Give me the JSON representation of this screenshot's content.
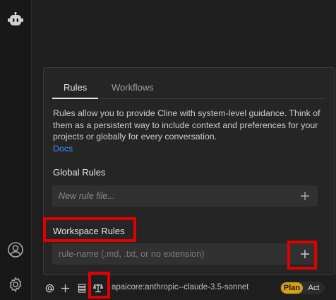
{
  "tabs": [
    {
      "label": "Rules",
      "active": true
    },
    {
      "label": "Workflows",
      "active": false
    }
  ],
  "description": "Rules allow you to provide Cline with system-level guidance. Think of them as a persistent way to include context and preferences for your projects or globally for every conversation.",
  "docs_link": "Docs",
  "global_rules": {
    "label": "Global Rules",
    "placeholder": "New rule file..."
  },
  "workspace_rules": {
    "label": "Workspace Rules",
    "placeholder": "rule-name (.md, .txt, or no extension)"
  },
  "toolbar": {
    "model": "apaicore:anthropic--claude-3.5-sonnet",
    "mode_plan": "Plan",
    "mode_act": "Act",
    "active_mode": "Plan"
  },
  "icons": {
    "activity_top": "cline-robot-icon",
    "activity_account": "account-icon",
    "activity_settings": "gear-icon",
    "toolbar_mention": "at-sign-icon",
    "toolbar_add": "plus-icon",
    "toolbar_server": "server-icon",
    "toolbar_rules": "scale-icon"
  },
  "colors": {
    "accent_link": "#3794ff",
    "plan_badge": "#d4a017",
    "annotation": "#e00000"
  }
}
